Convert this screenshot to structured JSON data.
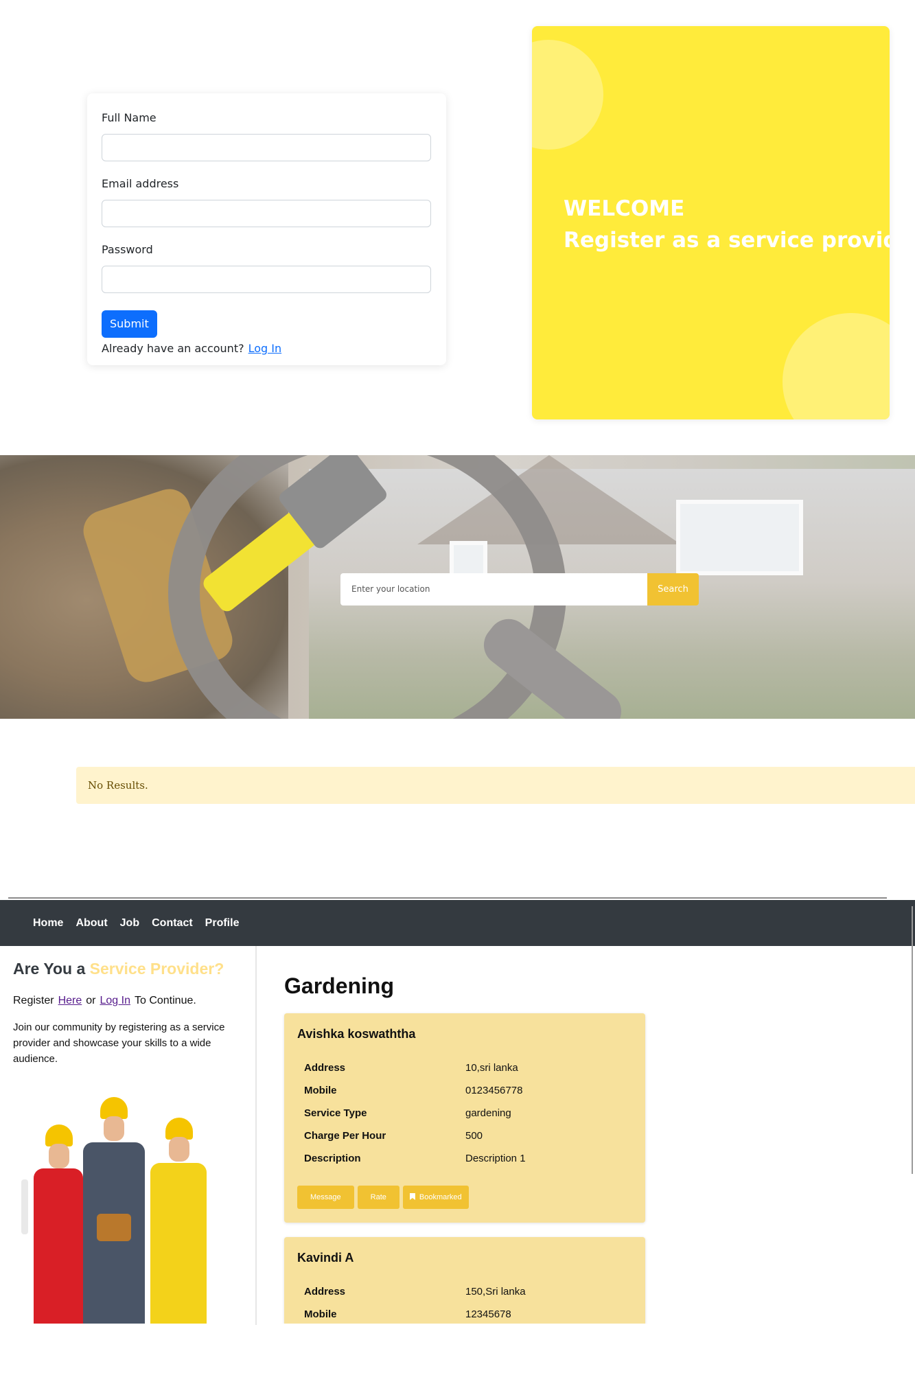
{
  "registration": {
    "fields": [
      {
        "label": "Full Name",
        "value": ""
      },
      {
        "label": "Email address",
        "value": ""
      },
      {
        "label": "Password",
        "value": ""
      }
    ],
    "submit_label": "Submit",
    "account_prompt": "Already have an account?",
    "login_link": "Log In"
  },
  "welcome": {
    "title": "WELCOME",
    "subtitle": "Register as a service provider",
    "color": "#ffeb3b"
  },
  "search": {
    "placeholder": "Enter your location",
    "button_label": "Search",
    "button_color": "#f1c232"
  },
  "results": {
    "message": "No Results."
  },
  "navbar": {
    "items": [
      "Home",
      "About",
      "Job",
      "Contact",
      "Profile"
    ]
  },
  "sidebar": {
    "heading_prefix": "Are You a",
    "heading_accent": "Service Provider?",
    "register_word": "Register",
    "here_link": "Here",
    "or_word": "or",
    "login_link": "Log In",
    "continue_word": "To Continue.",
    "join_text": "Join our community by registering as a service provider and showcase your skills to a wide audience."
  },
  "main": {
    "category_title": "Gardening",
    "providers": [
      {
        "name": "Avishka koswaththa",
        "details": [
          {
            "key": "Address",
            "value": "10,sri lanka"
          },
          {
            "key": "Mobile",
            "value": "0123456778"
          },
          {
            "key": "Service Type",
            "value": "gardening"
          },
          {
            "key": "Charge Per Hour",
            "value": "500"
          },
          {
            "key": "Description",
            "value": "Description 1"
          }
        ],
        "actions": {
          "message": "Message",
          "rate": "Rate",
          "bookmark": "Bookmarked"
        }
      },
      {
        "name": "Kavindi A",
        "details": [
          {
            "key": "Address",
            "value": "150,Sri lanka"
          },
          {
            "key": "Mobile",
            "value": "12345678"
          }
        ]
      }
    ]
  }
}
